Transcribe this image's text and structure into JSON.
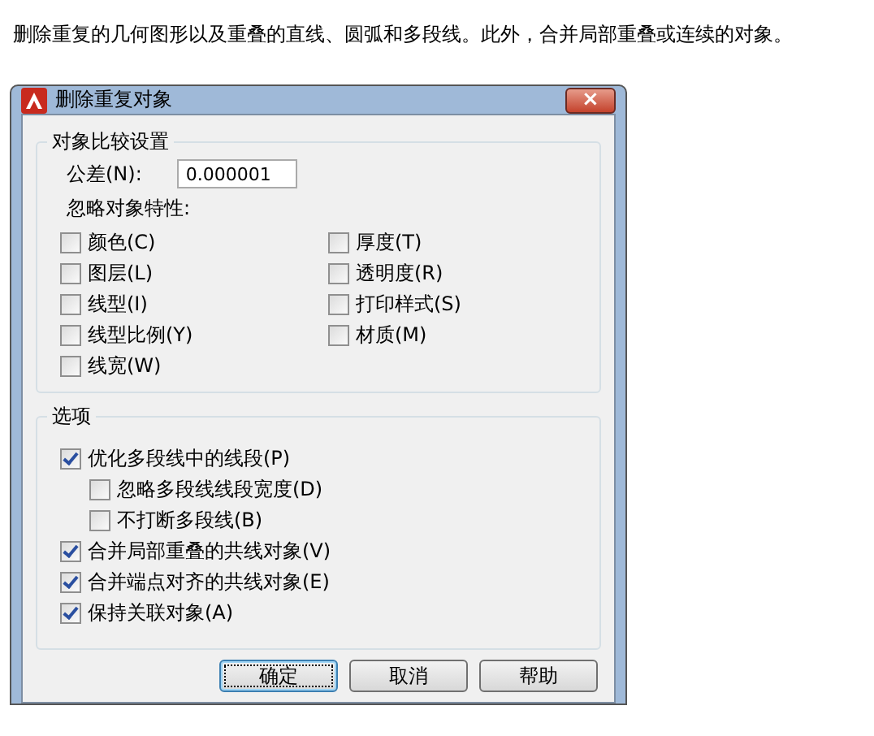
{
  "description": "删除重复的几何图形以及重叠的直线、圆弧和多段线。此外，合并局部重叠或连续的对象。",
  "window": {
    "title": "删除重复对象",
    "close": "×"
  },
  "comparison_group": {
    "title": "对象比较设置",
    "tolerance_label": "公差(N):",
    "tolerance_value": "0.000001",
    "ignore_label": "忽略对象特性:",
    "properties": [
      {
        "label": "颜色(C)",
        "checked": false
      },
      {
        "label": "厚度(T)",
        "checked": false
      },
      {
        "label": "图层(L)",
        "checked": false
      },
      {
        "label": "透明度(R)",
        "checked": false
      },
      {
        "label": "线型(I)",
        "checked": false
      },
      {
        "label": "打印样式(S)",
        "checked": false
      },
      {
        "label": "线型比例(Y)",
        "checked": false
      },
      {
        "label": "材质(M)",
        "checked": false
      },
      {
        "label": "线宽(W)",
        "checked": false
      }
    ]
  },
  "options_group": {
    "title": "选项",
    "options": [
      {
        "label": "优化多段线中的线段(P)",
        "checked": true,
        "children": [
          {
            "label": "忽略多段线线段宽度(D)",
            "checked": false
          },
          {
            "label": "不打断多段线(B)",
            "checked": false
          }
        ]
      },
      {
        "label": "合并局部重叠的共线对象(V)",
        "checked": true
      },
      {
        "label": "合并端点对齐的共线对象(E)",
        "checked": true
      },
      {
        "label": "保持关联对象(A)",
        "checked": true
      }
    ]
  },
  "buttons": [
    {
      "label": "确定",
      "selected": true
    },
    {
      "label": "取消",
      "selected": false
    },
    {
      "label": "帮助",
      "selected": false
    }
  ]
}
